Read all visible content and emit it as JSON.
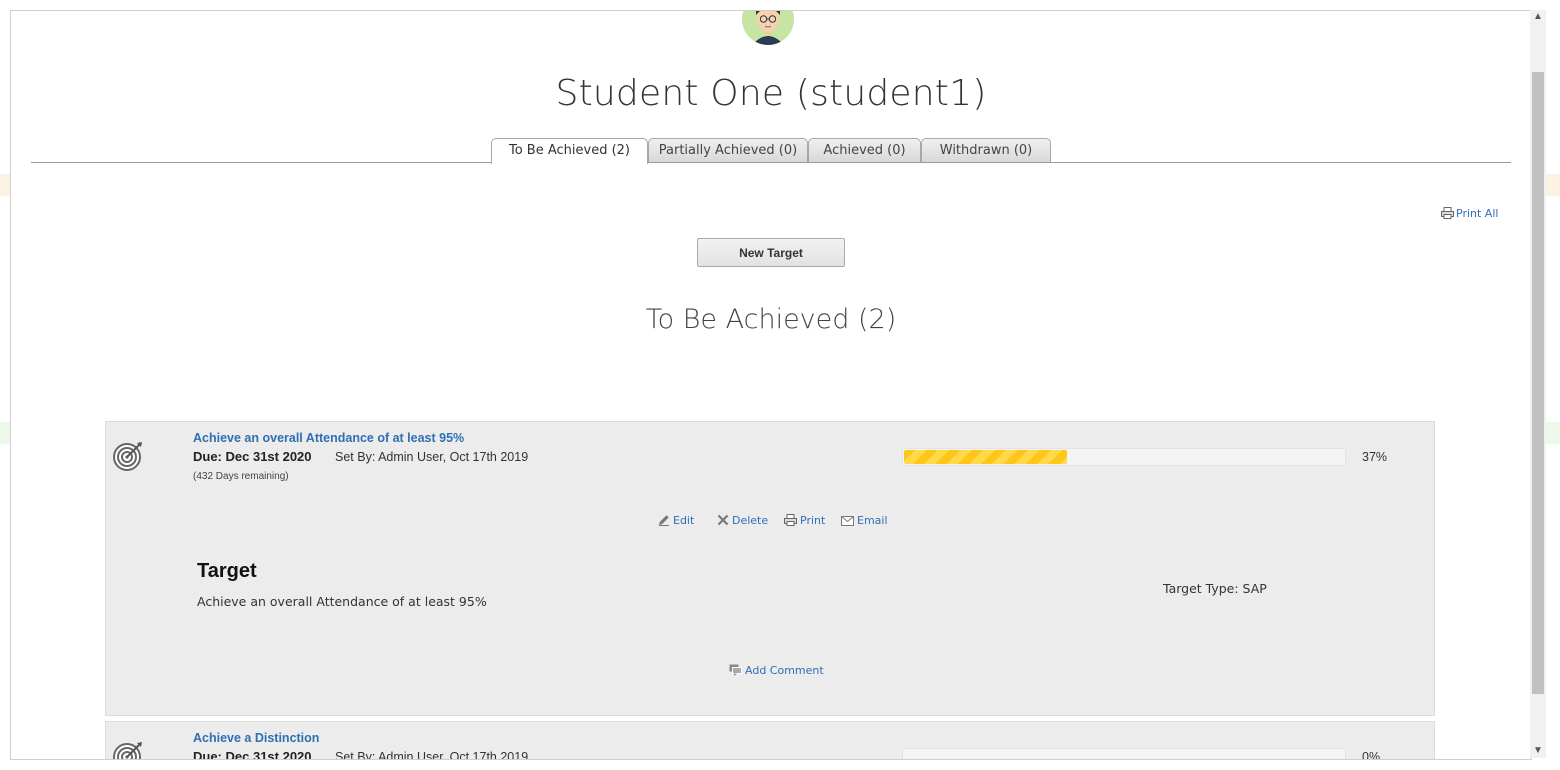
{
  "student": {
    "name": "Student One (student1)"
  },
  "tabs": [
    {
      "label": "To Be Achieved (2)",
      "active": true
    },
    {
      "label": "Partially Achieved (0)",
      "active": false
    },
    {
      "label": "Achieved (0)",
      "active": false
    },
    {
      "label": "Withdrawn (0)",
      "active": false
    }
  ],
  "toolbar": {
    "print_all_label": "Print All",
    "new_target_label": "New Target"
  },
  "section": {
    "title": "To Be Achieved (2)"
  },
  "targets": [
    {
      "title": "Achieve an overall Attendance of at least 95%",
      "due": "Due: Dec 31st 2020",
      "set_by": "Set By: Admin User, Oct 17th 2019",
      "remaining": "(432 Days remaining)",
      "progress_percent": 37,
      "progress_label": "37%",
      "actions": {
        "edit": "Edit",
        "delete": "Delete",
        "print": "Print",
        "email": "Email"
      },
      "detail_heading": "Target",
      "detail_text": "Achieve an overall Attendance of at least 95%",
      "target_type": "Target Type: SAP",
      "add_comment_label": "Add Comment"
    },
    {
      "title": "Achieve a Distinction",
      "due": "Due: Dec 31st 2020",
      "set_by": "Set By: Admin User, Oct 17th 2019",
      "progress_percent": 0,
      "progress_label": "0%"
    }
  ],
  "colors": {
    "link": "#2f6fb3",
    "progress": "#ffc61a",
    "card_bg": "#ececec"
  },
  "icons": {
    "avatar": "student-avatar",
    "target": "target-bullseye-icon",
    "print": "printer-icon",
    "edit": "pencil-icon",
    "delete": "x-icon",
    "email": "envelope-icon",
    "comment": "comment-icon"
  }
}
